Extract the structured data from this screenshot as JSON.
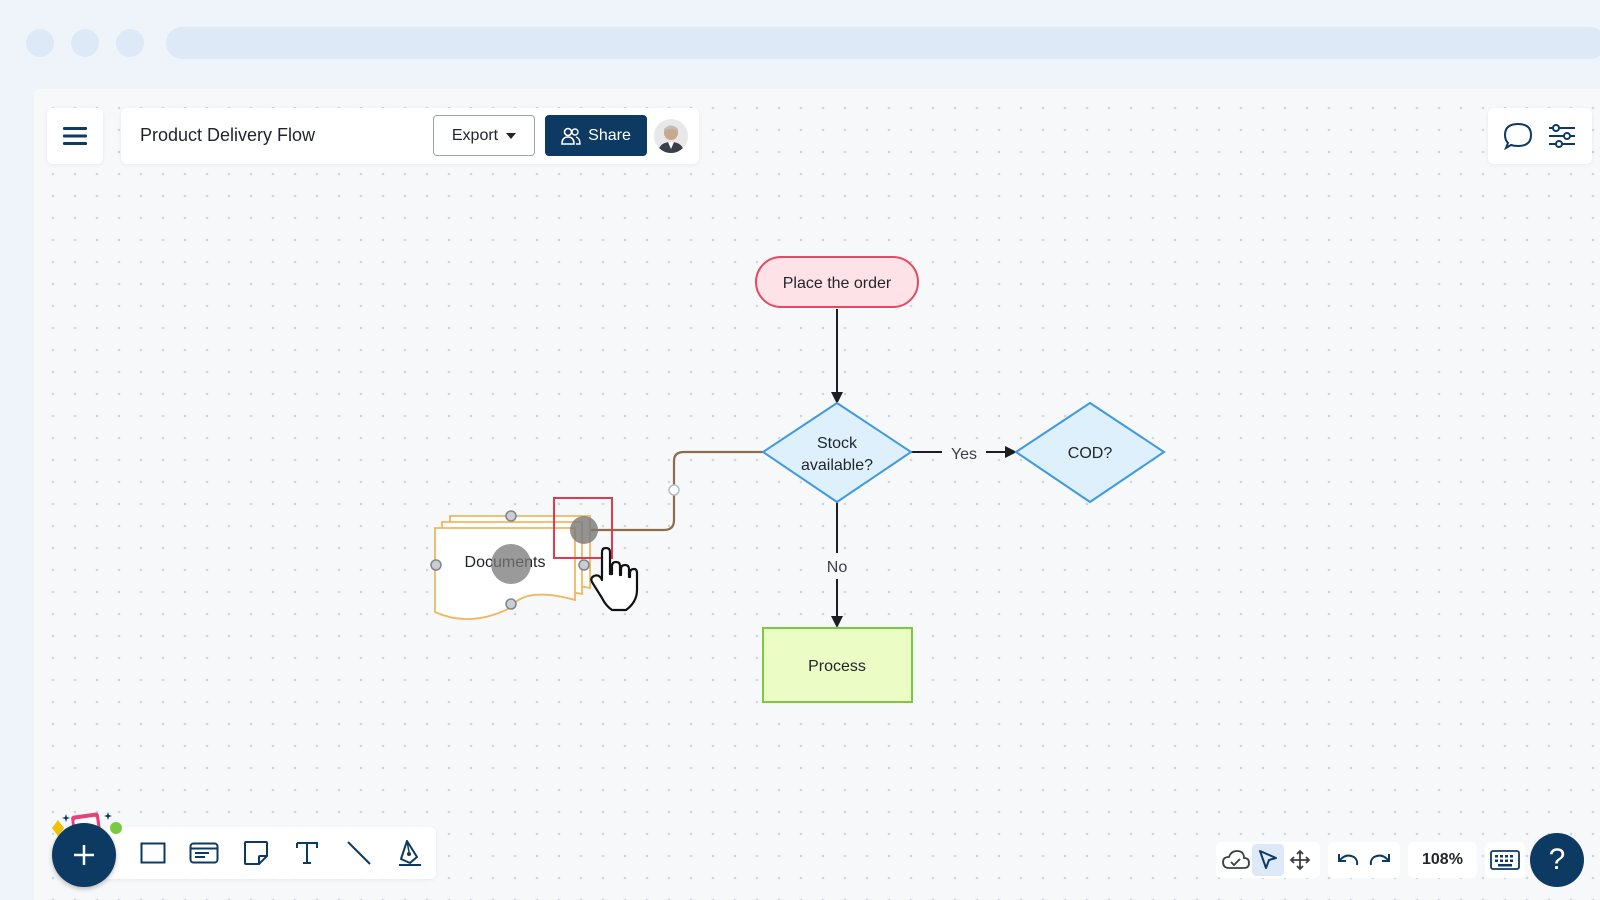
{
  "header": {
    "title": "Product Delivery Flow",
    "export_label": "Export",
    "share_label": "Share"
  },
  "icons": {
    "menu": "hamburger-icon",
    "export_caret": "caret-down-icon",
    "share": "people-icon",
    "comments": "chat-bubble-icon",
    "settings": "sliders-icon",
    "add": "plus-icon",
    "rectangle": "rectangle-icon",
    "card": "card-icon",
    "sticky_note": "sticky-note-icon",
    "text": "text-icon",
    "line": "line-icon",
    "pen": "pen-icon",
    "cloud": "cloud-icon",
    "select": "pointer-icon",
    "pan": "move-icon",
    "undo": "undo-icon",
    "redo": "redo-icon",
    "keyboard": "keyboard-icon",
    "help": "question-icon"
  },
  "diagram": {
    "nodes": {
      "start": "Place the order",
      "decision_stock_1": "Stock",
      "decision_stock_2": "available?",
      "decision_cod": "COD?",
      "process": "Process",
      "documents": "Documents"
    },
    "edges": {
      "yes": "Yes",
      "no": "No"
    }
  },
  "statusbar": {
    "zoom": "108%",
    "help": "?"
  },
  "colors": {
    "primary": "#0d3a63",
    "start_fill": "#fde3e7",
    "start_stroke": "#e44a62",
    "decision_fill": "#dff0fd",
    "decision_stroke": "#3f9ae0",
    "process_fill": "#ebfcc5",
    "process_stroke": "#7ac943",
    "documents_stroke": "#f2b660",
    "selection": "#e03a52"
  }
}
